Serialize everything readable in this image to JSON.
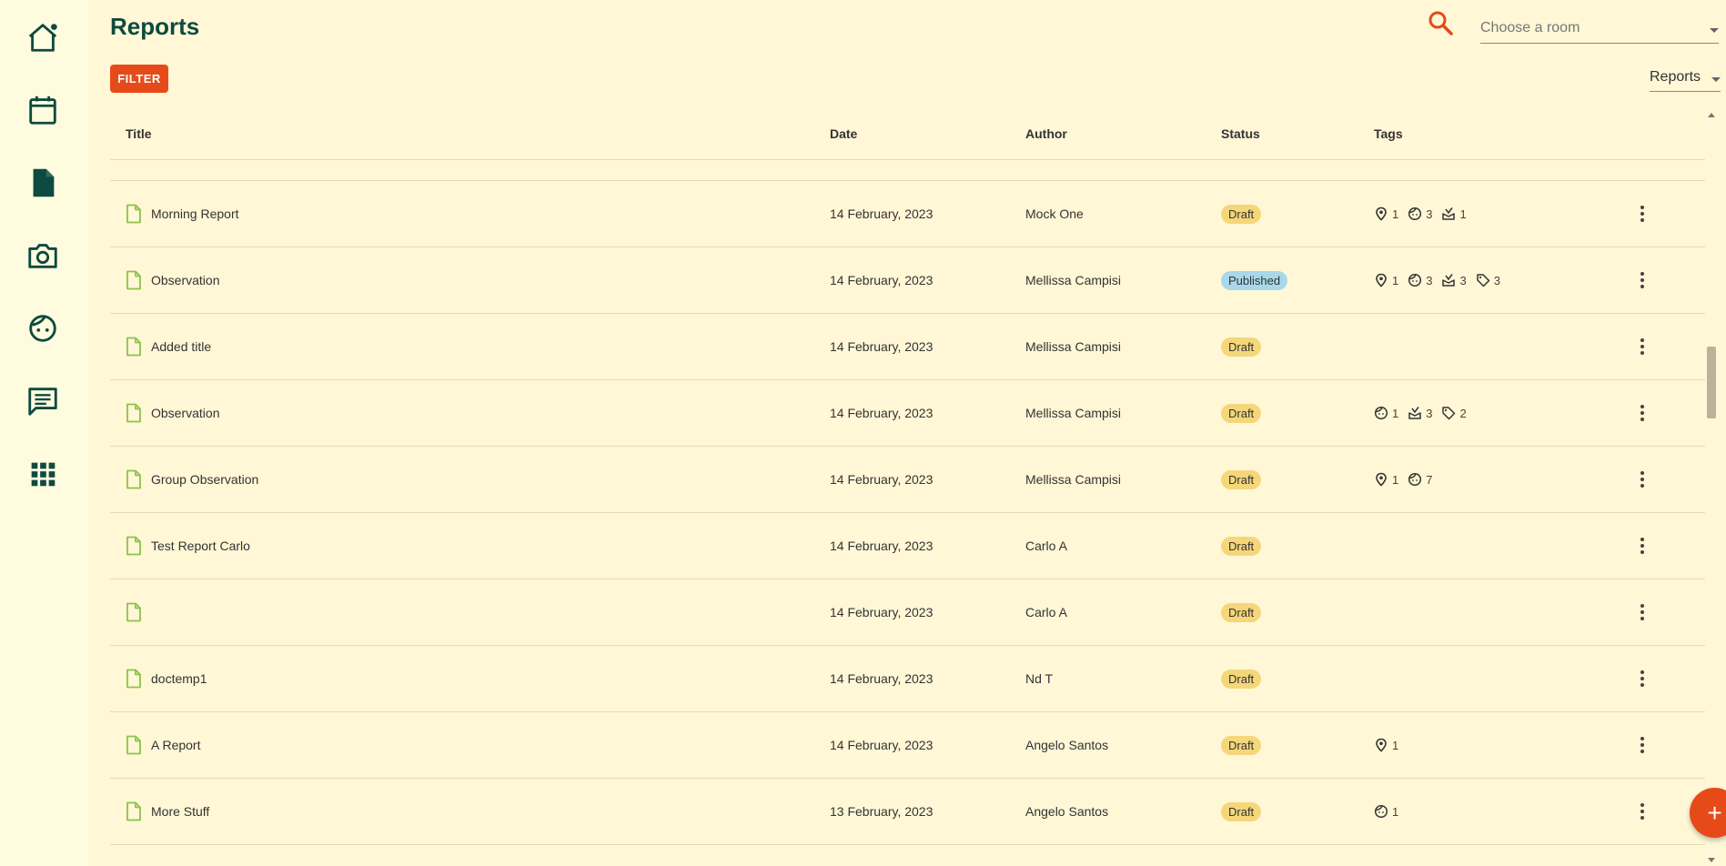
{
  "page": {
    "title": "Reports"
  },
  "toolbar": {
    "filter_label": "FILTER",
    "room_placeholder": "Choose a room",
    "view_value": "Reports"
  },
  "colors": {
    "accent": "#e64a19",
    "dark_green": "#0e4a3f",
    "doc_icon": "#8bc34a",
    "draft": "#f5d77a",
    "published": "#a8d8ea"
  },
  "sidebar": {
    "items": [
      {
        "icon": "home-icon"
      },
      {
        "icon": "calendar-icon"
      },
      {
        "icon": "document-icon"
      },
      {
        "icon": "camera-icon"
      },
      {
        "icon": "child-face-icon"
      },
      {
        "icon": "message-icon"
      },
      {
        "icon": "apps-grid-icon"
      }
    ]
  },
  "table": {
    "columns": {
      "title": "Title",
      "date": "Date",
      "author": "Author",
      "status": "Status",
      "tags": "Tags"
    },
    "rows": [
      {
        "title": "Morning Report",
        "date": "14 February, 2023",
        "author": "Mock One",
        "status": "Draft",
        "status_type": "draft",
        "tags": [
          {
            "icon": "location-pin-icon",
            "count": "1"
          },
          {
            "icon": "child-face-icon",
            "count": "3"
          },
          {
            "icon": "learning-icon",
            "count": "1"
          }
        ]
      },
      {
        "title": "Observation",
        "date": "14 February, 2023",
        "author": "Mellissa Campisi",
        "status": "Published",
        "status_type": "published",
        "tags": [
          {
            "icon": "location-pin-icon",
            "count": "1"
          },
          {
            "icon": "child-face-icon",
            "count": "3"
          },
          {
            "icon": "learning-icon",
            "count": "3"
          },
          {
            "icon": "tag-icon",
            "count": "3"
          }
        ]
      },
      {
        "title": "Added title",
        "date": "14 February, 2023",
        "author": "Mellissa Campisi",
        "status": "Draft",
        "status_type": "draft",
        "tags": []
      },
      {
        "title": "Observation",
        "date": "14 February, 2023",
        "author": "Mellissa Campisi",
        "status": "Draft",
        "status_type": "draft",
        "tags": [
          {
            "icon": "child-face-icon",
            "count": "1"
          },
          {
            "icon": "learning-icon",
            "count": "3"
          },
          {
            "icon": "tag-icon",
            "count": "2"
          }
        ]
      },
      {
        "title": "Group Observation",
        "date": "14 February, 2023",
        "author": "Mellissa Campisi",
        "status": "Draft",
        "status_type": "draft",
        "tags": [
          {
            "icon": "location-pin-icon",
            "count": "1"
          },
          {
            "icon": "child-face-icon",
            "count": "7"
          }
        ]
      },
      {
        "title": "Test Report Carlo",
        "date": "14 February, 2023",
        "author": "Carlo A",
        "status": "Draft",
        "status_type": "draft",
        "tags": []
      },
      {
        "title": "",
        "date": "14 February, 2023",
        "author": "Carlo A",
        "status": "Draft",
        "status_type": "draft",
        "tags": []
      },
      {
        "title": "doctemp1",
        "date": "14 February, 2023",
        "author": "Nd T",
        "status": "Draft",
        "status_type": "draft",
        "tags": []
      },
      {
        "title": "A Report",
        "date": "14 February, 2023",
        "author": "Angelo Santos",
        "status": "Draft",
        "status_type": "draft",
        "tags": [
          {
            "icon": "location-pin-icon",
            "count": "1"
          }
        ]
      },
      {
        "title": "More Stuff",
        "date": "13 February, 2023",
        "author": "Angelo Santos",
        "status": "Draft",
        "status_type": "draft",
        "tags": [
          {
            "icon": "child-face-icon",
            "count": "1"
          }
        ]
      }
    ]
  },
  "fab": {
    "label": "+"
  }
}
